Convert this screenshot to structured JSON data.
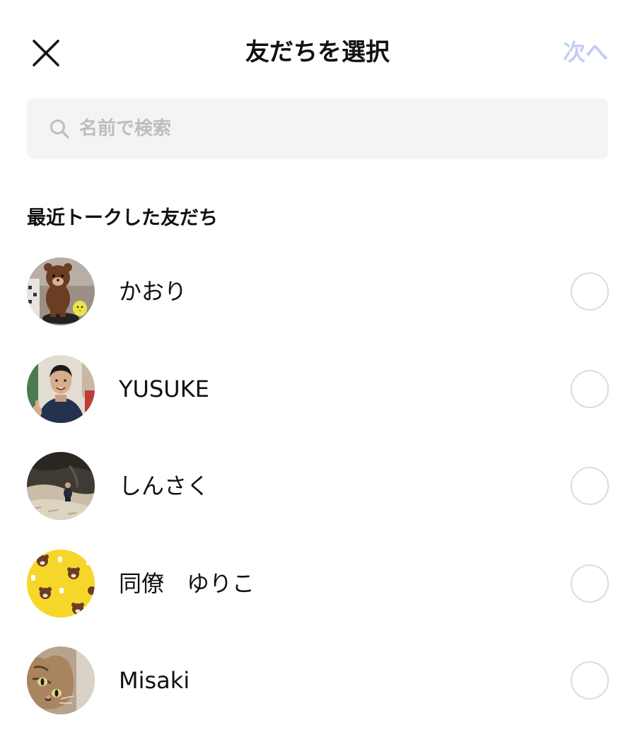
{
  "header": {
    "title": "友だちを選択",
    "next_label": "次へ",
    "close_icon": "close-icon",
    "next_color": "#c3cdf3"
  },
  "search": {
    "placeholder": "名前で検索",
    "value": "",
    "icon": "search-icon"
  },
  "section": {
    "title": "最近トークした友だち"
  },
  "friends": [
    {
      "name": "かおり",
      "avatar": "brown-bear-figure-photo",
      "selected": false
    },
    {
      "name": "YUSUKE",
      "avatar": "man-thumbs-up-photo",
      "selected": false
    },
    {
      "name": "しんさく",
      "avatar": "cave-photo",
      "selected": false
    },
    {
      "name": "同僚　ゆりこ",
      "avatar": "yellow-bear-pattern",
      "selected": false
    },
    {
      "name": "Misaki",
      "avatar": "cat-photo",
      "selected": false
    }
  ],
  "colors": {
    "search_bg": "#f4f4f4",
    "radio_border": "#dcdcdc",
    "text": "#111111"
  }
}
